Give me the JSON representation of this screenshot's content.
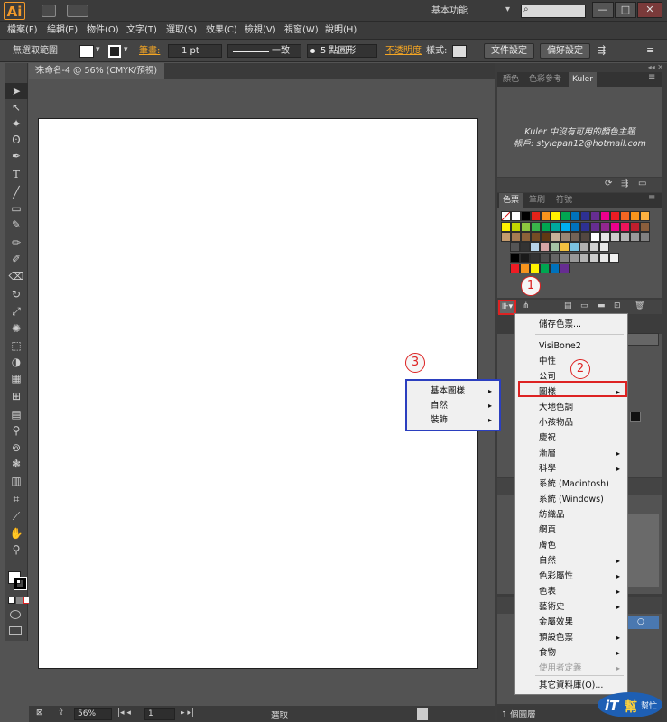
{
  "titlebar": {
    "logo": "Ai",
    "workspace": "基本功能",
    "window_buttons": [
      "—",
      "□",
      "✕"
    ]
  },
  "menubar": {
    "items": [
      "檔案(F)",
      "編輯(E)",
      "物件(O)",
      "文字(T)",
      "選取(S)",
      "效果(C)",
      "檢視(V)",
      "視窗(W)",
      "說明(H)"
    ]
  },
  "controlbar": {
    "selection": "無選取範圍",
    "stroke_label": "筆畫:",
    "stroke_value": "1 pt",
    "stroke_style": "一致",
    "brush": "5 點圓形",
    "opacity_label": "不透明度",
    "style_label": "樣式:",
    "doc_setup": "文件設定",
    "preferences": "偏好設定"
  },
  "document": {
    "tab_title": "未命名-4 @ 56% (CMYK/預視)"
  },
  "statusbar": {
    "zoom": "56%",
    "page": "1",
    "tool": "選取"
  },
  "panels": {
    "top_tabs": [
      "顏色",
      "色彩參考",
      "Kuler"
    ],
    "kuler_message_line1": "Kuler 中沒有可用的顏色主題",
    "kuler_message_line2": "帳戶: stylepan12@hotmail.com",
    "swatch_tabs": [
      "色票",
      "筆刷",
      "符號"
    ],
    "layers_count": "1 個圖層"
  },
  "swatch_library_menu": {
    "items": [
      {
        "label": "儲存色票...",
        "submenu": false,
        "disabled": false
      },
      {
        "label": "VisiBone2",
        "submenu": false,
        "disabled": false
      },
      {
        "label": "中性",
        "submenu": false,
        "disabled": false
      },
      {
        "label": "公司",
        "submenu": false,
        "disabled": false
      },
      {
        "label": "圖樣",
        "submenu": true,
        "disabled": false
      },
      {
        "label": "大地色調",
        "submenu": false,
        "disabled": false
      },
      {
        "label": "小孩物品",
        "submenu": false,
        "disabled": false
      },
      {
        "label": "慶祝",
        "submenu": false,
        "disabled": false
      },
      {
        "label": "漸層",
        "submenu": true,
        "disabled": false
      },
      {
        "label": "科學",
        "submenu": true,
        "disabled": false
      },
      {
        "label": "系統 (Macintosh)",
        "submenu": false,
        "disabled": false
      },
      {
        "label": "系統 (Windows)",
        "submenu": false,
        "disabled": false
      },
      {
        "label": "紡織品",
        "submenu": false,
        "disabled": false
      },
      {
        "label": "網頁",
        "submenu": false,
        "disabled": false
      },
      {
        "label": "膚色",
        "submenu": false,
        "disabled": false
      },
      {
        "label": "自然",
        "submenu": true,
        "disabled": false
      },
      {
        "label": "色彩屬性",
        "submenu": true,
        "disabled": false
      },
      {
        "label": "色表",
        "submenu": true,
        "disabled": false
      },
      {
        "label": "藝術史",
        "submenu": true,
        "disabled": false
      },
      {
        "label": "金屬效果",
        "submenu": false,
        "disabled": false
      },
      {
        "label": "預設色票",
        "submenu": true,
        "disabled": false
      },
      {
        "label": "食物",
        "submenu": true,
        "disabled": false
      },
      {
        "label": "使用者定義",
        "submenu": true,
        "disabled": true
      },
      {
        "label": "其它資料庫(O)...",
        "submenu": false,
        "disabled": false
      }
    ]
  },
  "pattern_submenu": {
    "items": [
      {
        "label": "基本圖樣",
        "submenu": true
      },
      {
        "label": "自然",
        "submenu": true
      },
      {
        "label": "裝飾",
        "submenu": true
      }
    ]
  },
  "callouts": [
    "1",
    "2",
    "3"
  ],
  "watermark": {
    "brand": "iT",
    "text": "幫",
    "sub": "幫忙"
  },
  "colors": {
    "highlight_red": "#dd2222",
    "highlight_blue": "#2b3fbf",
    "ai_orange": "#f39a2b"
  }
}
